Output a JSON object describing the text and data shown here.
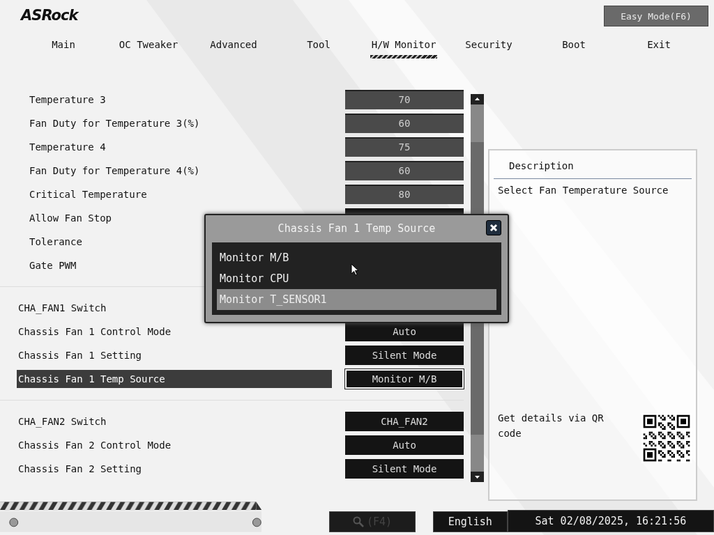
{
  "logo": "ASRock",
  "easy_mode_button": "Easy Mode(F6)",
  "tabs": [
    {
      "label": "Main",
      "selected": false
    },
    {
      "label": "OC Tweaker",
      "selected": false
    },
    {
      "label": "Advanced",
      "selected": false
    },
    {
      "label": "Tool",
      "selected": false
    },
    {
      "label": "H/W Monitor",
      "selected": true
    },
    {
      "label": "Security",
      "selected": false
    },
    {
      "label": "Boot",
      "selected": false
    },
    {
      "label": "Exit",
      "selected": false
    }
  ],
  "settings": [
    [
      {
        "label": "Temperature 3",
        "indented": true,
        "selected": false,
        "kind": "number",
        "value": "70"
      },
      {
        "label": "Fan Duty for Temperature 3(%)",
        "indented": true,
        "selected": false,
        "kind": "number",
        "value": "60"
      },
      {
        "label": "Temperature 4",
        "indented": true,
        "selected": false,
        "kind": "number",
        "value": "75"
      },
      {
        "label": "Fan Duty for Temperature 4(%)",
        "indented": true,
        "selected": false,
        "kind": "number",
        "value": "60"
      },
      {
        "label": "Critical Temperature",
        "indented": true,
        "selected": false,
        "kind": "number",
        "value": "80"
      },
      {
        "label": "Allow Fan Stop",
        "indented": true,
        "selected": false,
        "kind": "hidden"
      },
      {
        "label": "Tolerance",
        "indented": true,
        "selected": false,
        "kind": "none"
      },
      {
        "label": "Gate PWM",
        "indented": true,
        "selected": false,
        "kind": "none"
      }
    ],
    [
      {
        "label": "CHA_FAN1 Switch",
        "indented": false,
        "selected": false,
        "kind": "none"
      },
      {
        "label": "Chassis Fan 1 Control Mode",
        "indented": false,
        "selected": false,
        "kind": "option",
        "value": "Auto"
      },
      {
        "label": "Chassis Fan 1 Setting",
        "indented": false,
        "selected": false,
        "kind": "option",
        "value": "Silent Mode"
      },
      {
        "label": "Chassis Fan 1 Temp Source",
        "indented": false,
        "selected": true,
        "kind": "option",
        "value": "Monitor M/B"
      }
    ],
    [
      {
        "label": "CHA_FAN2 Switch",
        "indented": false,
        "selected": false,
        "kind": "option",
        "value": "CHA_FAN2"
      },
      {
        "label": "Chassis Fan 2 Control Mode",
        "indented": false,
        "selected": false,
        "kind": "option",
        "value": "Auto"
      },
      {
        "label": "Chassis Fan 2 Setting",
        "indented": false,
        "selected": false,
        "kind": "option",
        "value": "Silent Mode"
      }
    ]
  ],
  "description": {
    "title": "Description",
    "text": "Select Fan Temperature Source",
    "qr_text": "Get details via QR code"
  },
  "dialog": {
    "title": "Chassis Fan 1 Temp Source",
    "options": [
      {
        "label": "Monitor M/B",
        "selected": false
      },
      {
        "label": "Monitor CPU",
        "selected": false
      },
      {
        "label": "Monitor T_SENSOR1",
        "selected": true
      }
    ]
  },
  "footer": {
    "search": "(F4)",
    "language": "English",
    "datetime": "Sat 02/08/2025, 16:21:56"
  }
}
